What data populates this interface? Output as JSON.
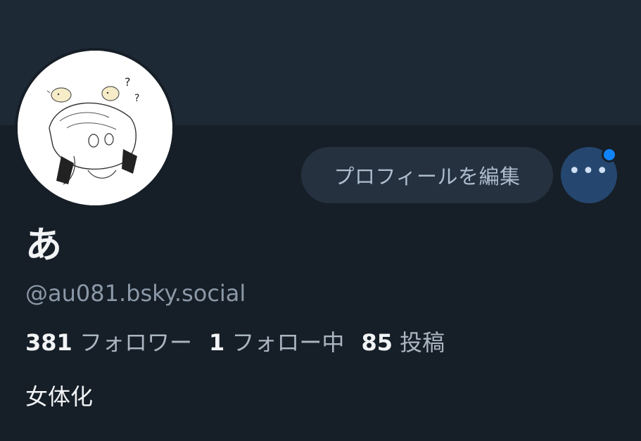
{
  "profile": {
    "display_name": "あ",
    "handle": "@au081.bsky.social",
    "bio": "女体化",
    "avatar_icon": "anime-character-avatar"
  },
  "actions": {
    "edit_profile_label": "プロフィールを編集",
    "more_label": "•••",
    "notification_dot_color": "#1083fe"
  },
  "stats": [
    {
      "value": "381",
      "label": "フォロワー"
    },
    {
      "value": "1",
      "label": "フォロー中"
    },
    {
      "value": "85",
      "label": "投稿"
    }
  ],
  "colors": {
    "background": "#161e27",
    "banner": "#1e2936",
    "accent": "#1083fe"
  }
}
